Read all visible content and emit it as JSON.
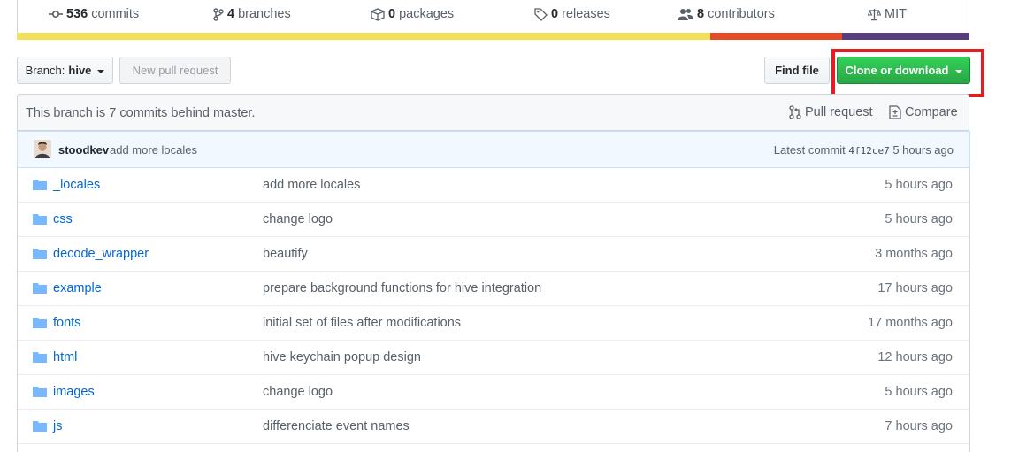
{
  "summary": {
    "commits": {
      "count": "536",
      "label": "commits",
      "icon": "history-icon"
    },
    "branches": {
      "count": "4",
      "label": "branches",
      "icon": "git-branch-icon"
    },
    "packages": {
      "count": "0",
      "label": "packages",
      "icon": "package-icon"
    },
    "releases": {
      "count": "0",
      "label": "releases",
      "icon": "tag-icon"
    },
    "contributors": {
      "count": "8",
      "label": "contributors",
      "icon": "people-icon"
    },
    "license": {
      "label": "MIT",
      "icon": "law-icon"
    }
  },
  "language_bar": [
    {
      "color": "#f1e05a",
      "share": 0.728
    },
    {
      "color": "#e34c26",
      "share": 0.138
    },
    {
      "color": "#563d7c",
      "share": 0.134
    }
  ],
  "toolbar": {
    "branch_prefix": "Branch:",
    "branch_name": "hive",
    "new_pull_request": "New pull request",
    "find_file": "Find file",
    "clone_or_download": "Clone or download"
  },
  "branch_info": {
    "message": "This branch is 7 commits behind master.",
    "pull_request": "Pull request",
    "compare": "Compare"
  },
  "latest_commit": {
    "author": "stoodkev",
    "message": "add more locales",
    "label": "Latest commit",
    "sha": "4f12ce7",
    "age": "5 hours ago"
  },
  "files": [
    {
      "name": "_locales",
      "message": "add more locales",
      "age": "5 hours ago"
    },
    {
      "name": "css",
      "message": "change logo",
      "age": "5 hours ago"
    },
    {
      "name": "decode_wrapper",
      "message": "beautify",
      "age": "3 months ago"
    },
    {
      "name": "example",
      "message": "prepare background functions for hive integration",
      "age": "17 hours ago"
    },
    {
      "name": "fonts",
      "message": "initial set of files after modifications",
      "age": "17 months ago"
    },
    {
      "name": "html",
      "message": "hive keychain popup design",
      "age": "12 hours ago"
    },
    {
      "name": "images",
      "message": "change logo",
      "age": "5 hours ago"
    },
    {
      "name": "js",
      "message": "differenciate event names",
      "age": "7 hours ago"
    }
  ],
  "colors": {
    "accent_green": "#28a745",
    "link_blue": "#0366d6",
    "highlight_red": "#e41c24",
    "folder_icon": "#79b8ff"
  }
}
